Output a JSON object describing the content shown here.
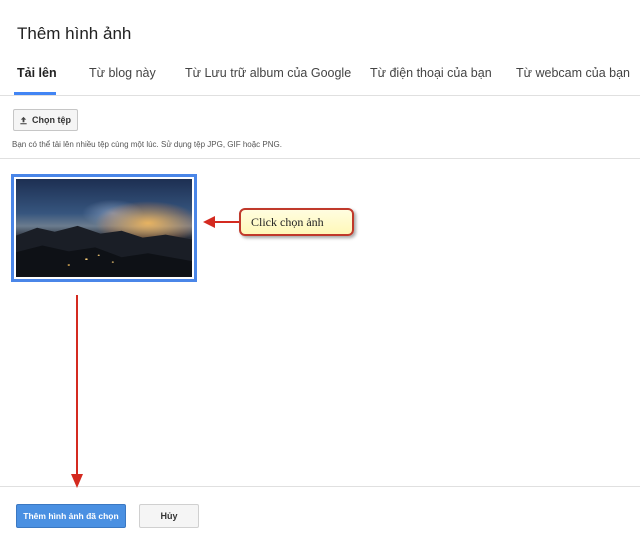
{
  "dialog": {
    "title": "Thêm hình ảnh"
  },
  "tabs": [
    {
      "label": "Tải lên",
      "active": true
    },
    {
      "label": "Từ blog này",
      "active": false
    },
    {
      "label": "Từ Lưu trữ album của Google",
      "active": false
    },
    {
      "label": "Từ điện thoại của bạn",
      "active": false
    },
    {
      "label": "Từ webcam của bạn",
      "active": false
    }
  ],
  "upload": {
    "choose_label": "Chọn tệp",
    "hint": "Bạn có thể tải lên nhiều tệp cùng một lúc. Sử dụng tệp JPG, GIF hoặc PNG."
  },
  "gallery": {
    "selected_count": 1
  },
  "annotation": {
    "callout_text": "Click chọn ảnh",
    "color": "#c0392b"
  },
  "footer": {
    "primary_label": "Thêm hình ảnh đã chọn",
    "cancel_label": "Hủy"
  },
  "colors": {
    "accent": "#4285f4",
    "primary_button": "#4a90e2",
    "selection_border": "#4a86e8"
  }
}
